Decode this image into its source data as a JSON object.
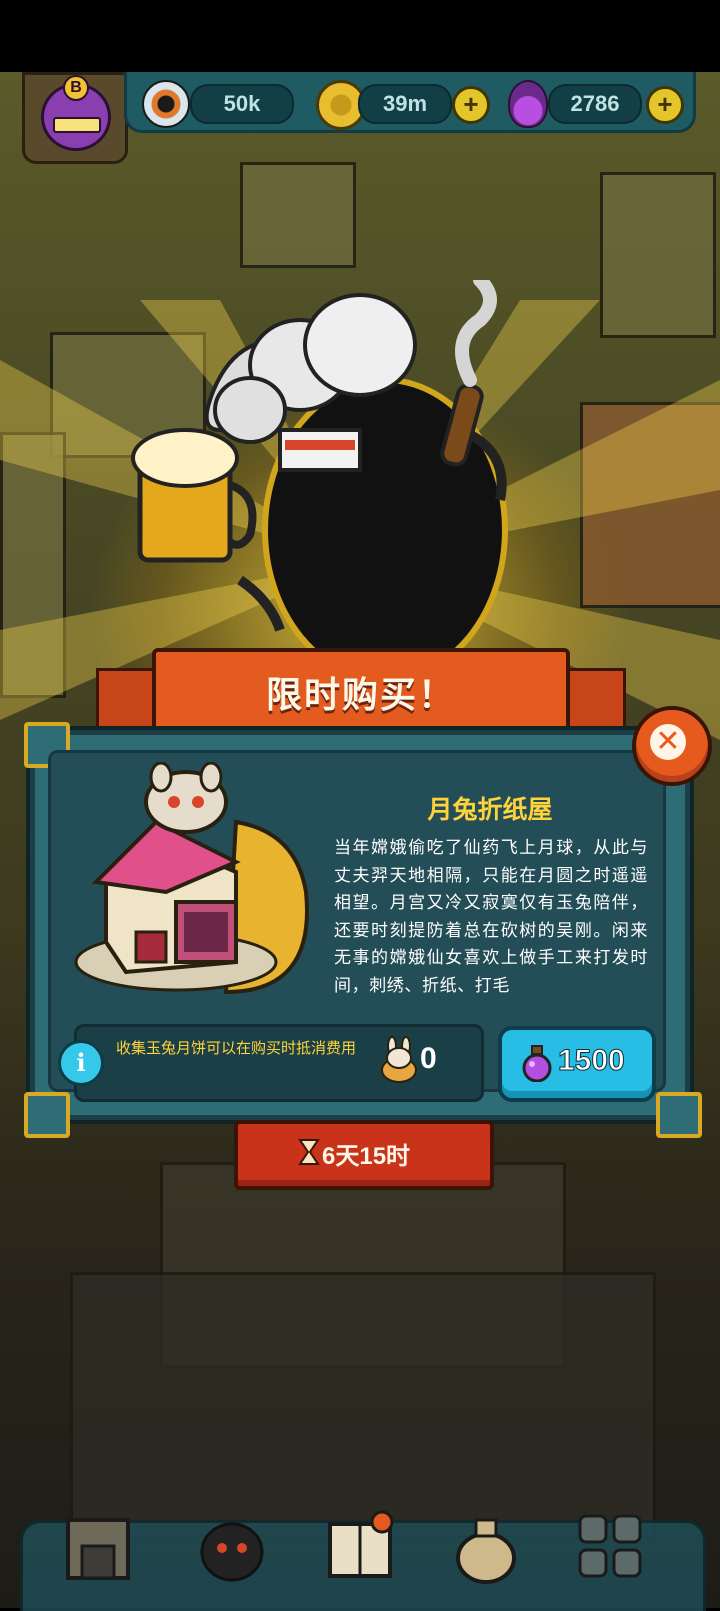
{
  "hud": {
    "eyes_value": "50k",
    "coins_value": "39m",
    "potions_value": "2786",
    "avatar_badge": "B"
  },
  "banner": {
    "title": "限时购买！"
  },
  "offer": {
    "item_name": "月兔折纸屋",
    "description": "当年嫦娥偷吃了仙药飞上月球，从此与丈夫羿天地相隔，只能在月圆之时遥遥相望。月宫又冷又寂寞仅有玉兔陪伴，还要时刻提防着总在砍树的吴刚。闲来无事的嫦娥仙女喜欢上做手工来打发时间，刺绣、折纸、打毛",
    "info_text": "收集玉兔月饼可以在购买时抵消费用",
    "mooncake_count": "0",
    "price": "1500",
    "timer": "6天15时"
  },
  "icons": {
    "close": "close-icon",
    "info": "info-icon",
    "currency": "potion-icon",
    "hourglass": "hourglass-icon"
  },
  "colors": {
    "panel": "#2f6d76",
    "ribbon": "#e45b20",
    "title_gold": "#ffd33a",
    "buy_button": "#27bde4",
    "plus_button": "#e3c72a"
  }
}
